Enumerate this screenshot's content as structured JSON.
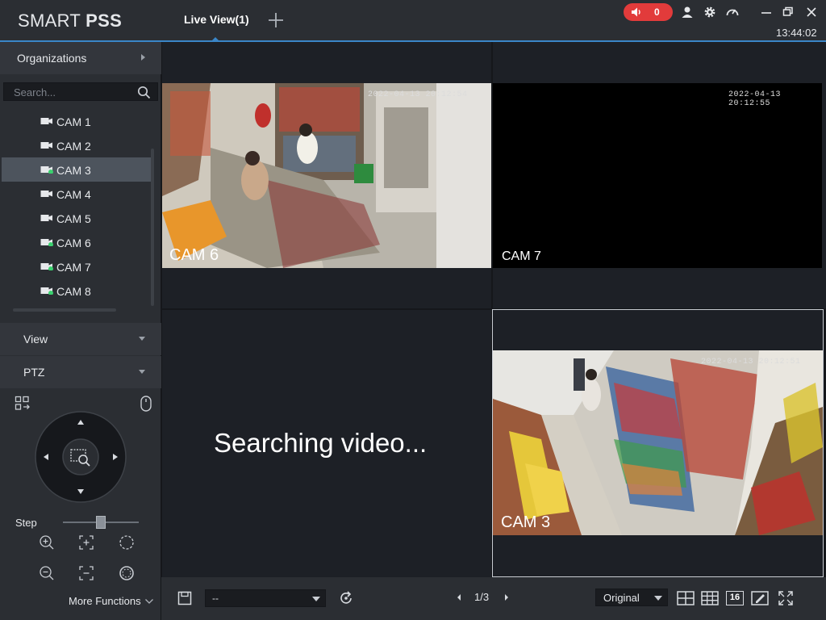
{
  "app": {
    "logo_light": "SMART ",
    "logo_bold": "PSS",
    "tab_label": "Live View(1)",
    "alarm_count": "0",
    "clock": "13:44:02"
  },
  "sidebar": {
    "organizations_label": "Organizations",
    "search_placeholder": "Search...",
    "cameras": [
      {
        "label": "CAM 1",
        "online": false,
        "selected": false
      },
      {
        "label": "CAM 2",
        "online": false,
        "selected": false
      },
      {
        "label": "CAM 3",
        "online": true,
        "selected": true
      },
      {
        "label": "CAM 4",
        "online": false,
        "selected": false
      },
      {
        "label": "CAM 5",
        "online": false,
        "selected": false
      },
      {
        "label": "CAM 6",
        "online": true,
        "selected": false
      },
      {
        "label": "CAM 7",
        "online": true,
        "selected": false
      },
      {
        "label": "CAM 8",
        "online": true,
        "selected": false
      }
    ],
    "view_label": "View",
    "ptz_label": "PTZ",
    "step_label": "Step",
    "step_level": 0.5,
    "more_functions_label": "More Functions"
  },
  "video": {
    "cell1": {
      "cam": "CAM 6",
      "timestamp": "2022-04-13 20:12:54"
    },
    "cell2": {
      "cam": "CAM 7",
      "timestamp": "2022-04-13 20:12:55"
    },
    "cell3": {
      "status": "Searching video..."
    },
    "cell4": {
      "cam": "CAM 3",
      "timestamp": "2022-04-13 20:12:51"
    }
  },
  "bottombar": {
    "stream_value": "--",
    "page": "1/3",
    "ratio_value": "Original",
    "layout_16_label": "16"
  },
  "colors": {
    "accent": "#3a86c8",
    "alarm": "#e23b3b",
    "online": "#3bd16f",
    "panel": "#2b2e33"
  }
}
